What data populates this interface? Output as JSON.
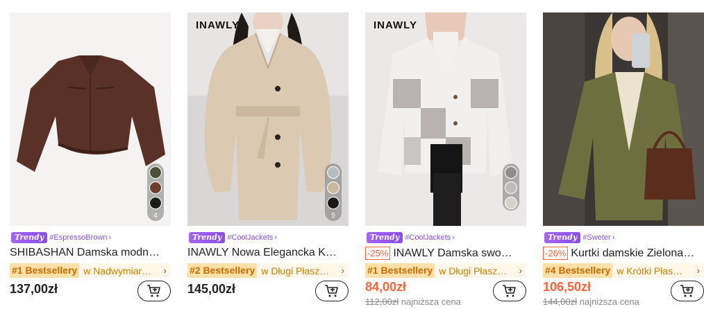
{
  "products": [
    {
      "brand_watermark": "",
      "trend_label": "Trendy",
      "hashtag": "#EspressoBrown",
      "discount": "",
      "title": "SHIBASHAN Damska modn…",
      "rank": "#1 Bestsellery",
      "rank_category": "w Nadwymiar…",
      "price": "137,00zł",
      "old_price": "",
      "lowest_label": "",
      "swatch_count": "4",
      "swatch_colors": [
        "#4b5138",
        "#6e3f2e",
        "#1b1b1b"
      ]
    },
    {
      "brand_watermark": "INAWLY",
      "trend_label": "Trendy",
      "hashtag": "#CoolJackets",
      "discount": "",
      "title": "INAWLY Nowa Elegancka K…",
      "rank": "#2 Bestsellery",
      "rank_category": "w Długi Płasz…",
      "price": "145,00zł",
      "old_price": "",
      "lowest_label": "",
      "swatch_count": "5",
      "swatch_colors": [
        "#b5bcc4",
        "#cbb89f",
        "#1a1a1a"
      ]
    },
    {
      "brand_watermark": "INAWLY",
      "trend_label": "Trendy",
      "hashtag": "#CoolJackets",
      "discount": "-25%",
      "title": "INAWLY Damska swo…",
      "rank": "#1 Bestsellery",
      "rank_category": "w Długi Płasz…",
      "price": "84,00zł",
      "old_price": "112,00zł",
      "lowest_label": "najniższa cena",
      "swatch_count": "",
      "swatch_colors": [
        "#8e8e8e",
        "#bdbdbd",
        "#d7d2cc"
      ]
    },
    {
      "brand_watermark": "",
      "trend_label": "Trendy",
      "hashtag": "#Sweter",
      "discount": "-26%",
      "title": "Kurtki damskie Zielona…",
      "rank": "#4 Bestsellery",
      "rank_category": "w Krótki Płas…",
      "price": "106,50zł",
      "old_price": "144,00zł",
      "lowest_label": "najniższa cena",
      "swatch_count": "",
      "swatch_colors": []
    }
  ],
  "icons": {
    "cart": "add-to-cart-icon",
    "chevron": "chevron-right-icon"
  },
  "colors": {
    "accent_sale": "#fa6338",
    "trend": "#8a4fe0",
    "rank_text": "#c96a00"
  }
}
